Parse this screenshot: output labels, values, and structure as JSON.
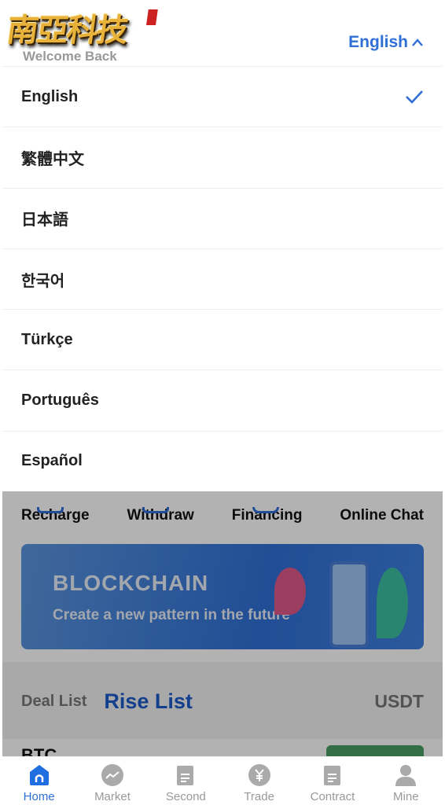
{
  "logo_text": "南亞科技",
  "header": {
    "welcome": "Welcome Back",
    "language_toggle": "English"
  },
  "language_menu": {
    "selected": "English",
    "items": [
      "English",
      "繁體中文",
      "日本語",
      "한국어",
      "Türkçe",
      "Português",
      "Español"
    ]
  },
  "quick_actions": [
    "Recharge",
    "Withdraw",
    "Financing",
    "Online Chat"
  ],
  "banner": {
    "title": "BLOCKCHAIN",
    "subtitle": "Create a new pattern in the future"
  },
  "list_tabs": {
    "deal": "Deal List",
    "rise": "Rise List",
    "currency": "USDT"
  },
  "first_row": {
    "symbol": "BTC"
  },
  "colors": {
    "accent": "#2f6fd6",
    "rise_green": "#4a9e66"
  },
  "bottom_nav": {
    "active": "Home",
    "items": [
      {
        "label": "Home",
        "icon": "home-icon"
      },
      {
        "label": "Market",
        "icon": "chart-trend-icon"
      },
      {
        "label": "Second",
        "icon": "document-icon"
      },
      {
        "label": "Trade",
        "icon": "yen-coin-icon"
      },
      {
        "label": "Contract",
        "icon": "document-icon"
      },
      {
        "label": "Mine",
        "icon": "user-icon"
      }
    ]
  }
}
